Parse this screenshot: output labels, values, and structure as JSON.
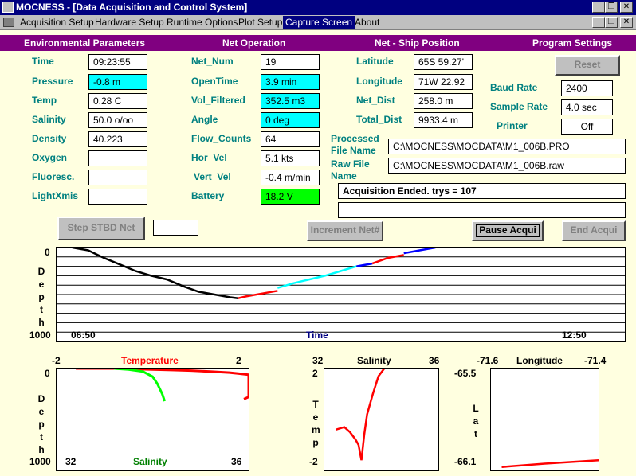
{
  "window": {
    "title": "MOCNESS - [Data Acquisition and Control System]",
    "min_glyph": "_",
    "restore_glyph": "❐",
    "close_glyph": "✕"
  },
  "menu": [
    "Acquisition Setup",
    "Hardware Setup",
    "Runtime Options",
    "Plot Setup",
    "Capture Screen",
    "About"
  ],
  "selected_menu": "Capture Screen",
  "sections": {
    "environmental": "Environmental Parameters",
    "net_operation": "Net Operation",
    "ship_position": "Net - Ship Position",
    "program_settings": "Program Settings"
  },
  "environmental": {
    "time_label": "Time",
    "time_value": "09:23:55",
    "pressure_label": "Pressure",
    "pressure_value": "-0.8 m",
    "temp_label": "Temp",
    "temp_value": "0.28 C",
    "salinity_label": "Salinity",
    "salinity_value": "50.0 o/oo",
    "density_label": "Density",
    "density_value": "40.223",
    "oxygen_label": "Oxygen",
    "oxygen_value": "",
    "fluoresc_label": "Fluoresc.",
    "fluoresc_value": "",
    "lightxmis_label": "LightXmis",
    "lightxmis_value": ""
  },
  "net": {
    "net_num_label": "Net_Num",
    "net_num_value": "19",
    "opentime_label": "OpenTime",
    "opentime_value": "3.9 min",
    "vol_label": "Vol_Filtered",
    "vol_value": "352.5 m3",
    "angle_label": "Angle",
    "angle_value": "0 deg",
    "flow_label": "Flow_Counts",
    "flow_value": "64",
    "horvel_label": "Hor_Vel",
    "horvel_value": "5.1 kts",
    "vertvel_label": "Vert_Vel",
    "vertvel_value": "-0.4 m/min",
    "battery_label": "Battery",
    "battery_value": "18.2 V"
  },
  "position": {
    "lat_label": "Latitude",
    "lat_value": "65S 59.27'",
    "lon_label": "Longitude",
    "lon_value": "71W 22.92",
    "netdist_label": "Net_Dist",
    "netdist_value": "258.0 m",
    "totaldist_label": "Total_Dist",
    "totaldist_value": "9933.4 m"
  },
  "settings": {
    "reset_label": "Reset",
    "baud_label": "Baud Rate",
    "baud_value": "2400",
    "sample_label": "Sample Rate",
    "sample_value": "4.0 sec",
    "printer_label": "Printer",
    "printer_value": "Off"
  },
  "files": {
    "processed_label_1": "Processed",
    "processed_label_2": "File Name",
    "processed_value": "C:\\MOCNESS\\MOCDATA\\M1_006B.PRO",
    "raw_label_1": "Raw File",
    "raw_label_2": "Name",
    "raw_value": "C:\\MOCNESS\\MOCDATA\\M1_006B.raw",
    "status_value": "Acquisition Ended.  trys = 107",
    "status2_value": ""
  },
  "buttons": {
    "step": "Step STBD Net",
    "step_field": "",
    "increment": "Increment Net#",
    "pause": "Pause Acqui",
    "end": "End Acqui"
  },
  "depth_time_plot": {
    "y_top": "0",
    "y_bottom": "1000",
    "x_left": "06:50",
    "x_right": "12:50",
    "x_title": "Time",
    "y_title_letters": [
      "D",
      "e",
      "p",
      "t",
      "h"
    ]
  },
  "temp_sal_plot": {
    "top_left": "-2",
    "top_title": "Temperature",
    "top_right": "2",
    "y_top": "0",
    "y_bottom": "1000",
    "bottom_left": "32",
    "bottom_title": "Salinity",
    "bottom_right": "36",
    "y_title_letters": [
      "D",
      "e",
      "p",
      "t",
      "h"
    ]
  },
  "ts_plot": {
    "top_left": "32",
    "top_title": "Salinity",
    "top_right": "36",
    "y_top": "2",
    "y_bottom": "-2",
    "y_title_letters": [
      "T",
      "e",
      "m",
      "p"
    ]
  },
  "latlon_plot": {
    "top_left": "-71.6",
    "top_title": "Longitude",
    "top_right": "-71.4",
    "y_top": "-65.5",
    "y_bottom": "-66.1",
    "y_title_letters": [
      "L",
      "a",
      "t"
    ]
  },
  "colors": {
    "title_bar": "#000080",
    "section_bar": "#800080",
    "label": "#008080",
    "cyan_field": "#00FFFF",
    "green_field": "#00FF00",
    "page": "#FFFFE0"
  },
  "chart_data": [
    {
      "type": "line",
      "title": "",
      "xlabel": "Time",
      "ylabel": "Depth",
      "xlim": [
        "06:50",
        "12:50"
      ],
      "ylim": [
        1000,
        0
      ],
      "series": [
        {
          "color": "#000000",
          "x": [
            "07:00",
            "07:10",
            "07:20",
            "07:30",
            "07:40",
            "07:50",
            "08:00",
            "08:10",
            "08:20",
            "08:30",
            "08:40",
            "08:45"
          ],
          "y": [
            0,
            30,
            110,
            180,
            250,
            300,
            340,
            410,
            470,
            500,
            530,
            540
          ]
        },
        {
          "color": "#FF0000",
          "x": [
            "08:45",
            "08:50",
            "09:00",
            "09:10"
          ],
          "y": [
            540,
            520,
            490,
            460
          ]
        },
        {
          "color": "#00FFFF",
          "x": [
            "09:10",
            "09:20",
            "09:30",
            "09:40",
            "09:50",
            "10:00"
          ],
          "y": [
            430,
            380,
            340,
            300,
            250,
            200
          ]
        },
        {
          "color": "#0000FF",
          "x": [
            "10:00",
            "10:10"
          ],
          "y": [
            200,
            170
          ]
        },
        {
          "color": "#FF0000",
          "x": [
            "10:10",
            "10:20",
            "10:30"
          ],
          "y": [
            170,
            110,
            80
          ]
        },
        {
          "color": "#0000FF",
          "x": [
            "10:30",
            "10:40",
            "10:50"
          ],
          "y": [
            60,
            30,
            0
          ]
        }
      ]
    },
    {
      "type": "scatter",
      "title": "Temperature",
      "xlabel": "Salinity",
      "ylabel": "Depth",
      "xlim_top": [
        -2,
        2
      ],
      "xlim_bottom": [
        32,
        36
      ],
      "ylim": [
        1000,
        0
      ],
      "series": [
        {
          "name": "Temperature",
          "color": "#FF0000",
          "x": [
            -1.6,
            -1.2,
            -0.8,
            -0.4,
            0.0,
            0.4,
            0.8,
            1.2,
            1.6,
            1.8,
            2.0,
            2.0,
            1.9
          ],
          "y": [
            0,
            0,
            0,
            5,
            10,
            15,
            20,
            30,
            40,
            50,
            60,
            280,
            300
          ]
        },
        {
          "name": "Salinity",
          "color": "#00FF00",
          "x": [
            33.2,
            33.5,
            33.8,
            34.0,
            34.1,
            34.2,
            34.25
          ],
          "y": [
            0,
            10,
            30,
            80,
            150,
            250,
            320
          ]
        }
      ]
    },
    {
      "type": "scatter",
      "title": "Salinity",
      "xlabel": "Salinity",
      "ylabel": "Temp",
      "xlim": [
        32,
        36
      ],
      "ylim": [
        -2,
        2
      ],
      "series": [
        {
          "color": "#FF0000",
          "x": [
            32.4,
            32.7,
            32.9,
            33.1,
            33.2,
            33.3,
            33.4,
            33.5,
            33.7,
            33.9,
            34.1
          ],
          "y": [
            -0.4,
            -0.3,
            -0.5,
            -0.8,
            -1.0,
            -1.6,
            -0.6,
            0.2,
            1.0,
            1.7,
            2.0
          ]
        }
      ]
    },
    {
      "type": "line",
      "title": "Longitude",
      "xlabel": "Longitude",
      "ylabel": "Lat",
      "xlim": [
        -71.6,
        -71.4
      ],
      "ylim": [
        -66.1,
        -65.5
      ],
      "series": [
        {
          "color": "#FF0000",
          "x": [
            -71.58,
            -71.5,
            -71.4
          ],
          "y": [
            -66.08,
            -66.06,
            -66.04
          ]
        }
      ]
    }
  ]
}
